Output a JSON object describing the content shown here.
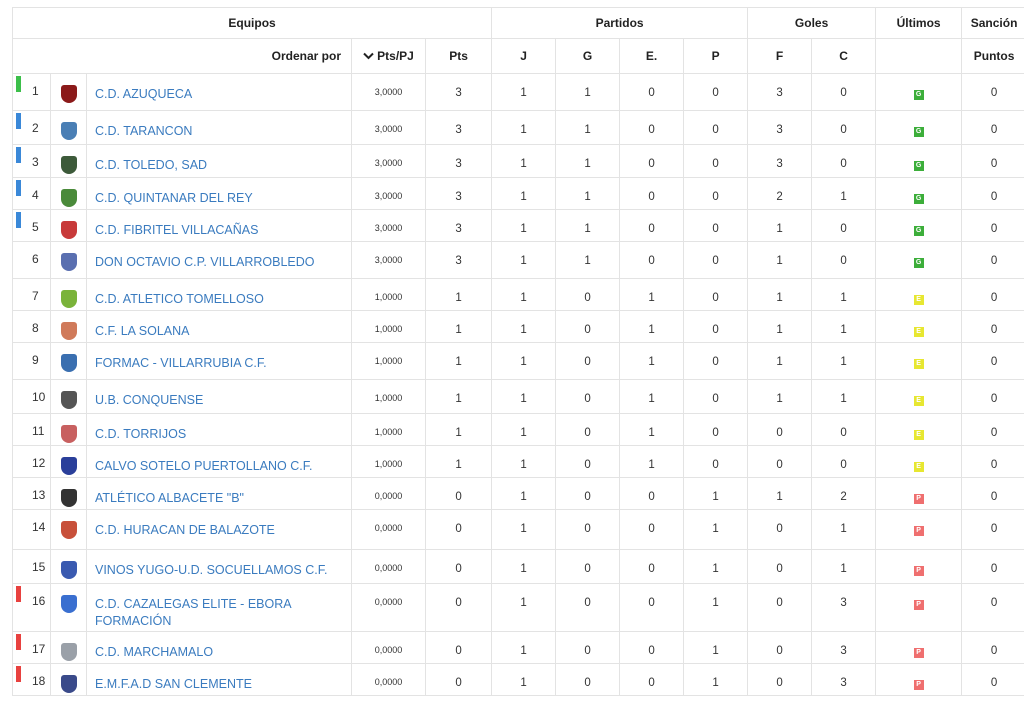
{
  "header": {
    "equipos": "Equipos",
    "partidos": "Partidos",
    "goles": "Goles",
    "ultimos": "Últimos",
    "sancion": "Sanción",
    "ordenar_por": "Ordenar por",
    "sort_icon": "chevron-down-icon",
    "pts_pj": "Pts/PJ",
    "pts": "Pts",
    "j": "J",
    "g": "G",
    "e": "E.",
    "p": "P",
    "f": "F",
    "c": "C",
    "puntos": "Puntos"
  },
  "colors": {
    "promo_green": "#3cbf4a",
    "playoff_blue": "#3a88d8",
    "relegation_red": "#e8413f",
    "win_tag": "#3cae3a",
    "draw_tag": "#e7e731",
    "loss_tag": "#ef6f6f",
    "link": "#3a7bbf"
  },
  "rows": [
    {
      "pos": "1",
      "name": "C.D. AZUQUECA",
      "ptspj": "3,0000",
      "pts": "3",
      "j": "1",
      "g": "1",
      "e": "0",
      "p": "0",
      "f": "3",
      "c": "0",
      "ult": "G",
      "sancion": "0",
      "bar": "green",
      "shield": "#8b1a1a"
    },
    {
      "pos": "2",
      "name": "C.D. TARANCON",
      "ptspj": "3,0000",
      "pts": "3",
      "j": "1",
      "g": "1",
      "e": "0",
      "p": "0",
      "f": "3",
      "c": "0",
      "ult": "G",
      "sancion": "0",
      "bar": "blue",
      "shield": "#4a7fb5"
    },
    {
      "pos": "3",
      "name": "C.D. TOLEDO, SAD",
      "ptspj": "3,0000",
      "pts": "3",
      "j": "1",
      "g": "1",
      "e": "0",
      "p": "0",
      "f": "3",
      "c": "0",
      "ult": "G",
      "sancion": "0",
      "bar": "blue",
      "shield": "#3d5a3a"
    },
    {
      "pos": "4",
      "name": "C.D. QUINTANAR DEL REY",
      "ptspj": "3,0000",
      "pts": "3",
      "j": "1",
      "g": "1",
      "e": "0",
      "p": "0",
      "f": "2",
      "c": "1",
      "ult": "G",
      "sancion": "0",
      "bar": "blue",
      "shield": "#4a8a3a"
    },
    {
      "pos": "5",
      "name": "C.D. FIBRITEL VILLACAÑAS",
      "ptspj": "3,0000",
      "pts": "3",
      "j": "1",
      "g": "1",
      "e": "0",
      "p": "0",
      "f": "1",
      "c": "0",
      "ult": "G",
      "sancion": "0",
      "bar": "blue",
      "shield": "#c83a3a"
    },
    {
      "pos": "6",
      "name": "DON OCTAVIO C.P. VILLARROBLEDO",
      "ptspj": "3,0000",
      "pts": "3",
      "j": "1",
      "g": "1",
      "e": "0",
      "p": "0",
      "f": "1",
      "c": "0",
      "ult": "G",
      "sancion": "0",
      "bar": "",
      "shield": "#5a6fb0"
    },
    {
      "pos": "7",
      "name": "C.D. ATLETICO TOMELLOSO",
      "ptspj": "1,0000",
      "pts": "1",
      "j": "1",
      "g": "0",
      "e": "1",
      "p": "0",
      "f": "1",
      "c": "1",
      "ult": "E",
      "sancion": "0",
      "bar": "",
      "shield": "#7ab33a"
    },
    {
      "pos": "8",
      "name": "C.F. LA SOLANA",
      "ptspj": "1,0000",
      "pts": "1",
      "j": "1",
      "g": "0",
      "e": "1",
      "p": "0",
      "f": "1",
      "c": "1",
      "ult": "E",
      "sancion": "0",
      "bar": "",
      "shield": "#d07a5a"
    },
    {
      "pos": "9",
      "name": "FORMAC - VILLARRUBIA C.F.",
      "ptspj": "1,0000",
      "pts": "1",
      "j": "1",
      "g": "0",
      "e": "1",
      "p": "0",
      "f": "1",
      "c": "1",
      "ult": "E",
      "sancion": "0",
      "bar": "",
      "shield": "#3a6fb0"
    },
    {
      "pos": "10",
      "name": "U.B. CONQUENSE",
      "ptspj": "1,0000",
      "pts": "1",
      "j": "1",
      "g": "0",
      "e": "1",
      "p": "0",
      "f": "1",
      "c": "1",
      "ult": "E",
      "sancion": "0",
      "bar": "",
      "shield": "#555555"
    },
    {
      "pos": "11",
      "name": "C.D. TORRIJOS",
      "ptspj": "1,0000",
      "pts": "1",
      "j": "1",
      "g": "0",
      "e": "1",
      "p": "0",
      "f": "0",
      "c": "0",
      "ult": "E",
      "sancion": "0",
      "bar": "",
      "shield": "#c86060"
    },
    {
      "pos": "12",
      "name": "CALVO SOTELO PUERTOLLANO C.F.",
      "ptspj": "1,0000",
      "pts": "1",
      "j": "1",
      "g": "0",
      "e": "1",
      "p": "0",
      "f": "0",
      "c": "0",
      "ult": "E",
      "sancion": "0",
      "bar": "",
      "shield": "#2a3f9a"
    },
    {
      "pos": "13",
      "name": "ATLÉTICO ALBACETE \"B\"",
      "ptspj": "0,0000",
      "pts": "0",
      "j": "1",
      "g": "0",
      "e": "0",
      "p": "1",
      "f": "1",
      "c": "2",
      "ult": "P",
      "sancion": "0",
      "bar": "",
      "shield": "#333333"
    },
    {
      "pos": "14",
      "name": "C.D. HURACAN DE BALAZOTE",
      "ptspj": "0,0000",
      "pts": "0",
      "j": "1",
      "g": "0",
      "e": "0",
      "p": "1",
      "f": "0",
      "c": "1",
      "ult": "P",
      "sancion": "0",
      "bar": "",
      "shield": "#c8503a"
    },
    {
      "pos": "15",
      "name": "VINOS YUGO-U.D. SOCUELLAMOS C.F.",
      "ptspj": "0,0000",
      "pts": "0",
      "j": "1",
      "g": "0",
      "e": "0",
      "p": "1",
      "f": "0",
      "c": "1",
      "ult": "P",
      "sancion": "0",
      "bar": "",
      "shield": "#3a5ab0"
    },
    {
      "pos": "16",
      "name": "C.D. CAZALEGAS ELITE - EBORA FORMACIÓN",
      "ptspj": "0,0000",
      "pts": "0",
      "j": "1",
      "g": "0",
      "e": "0",
      "p": "1",
      "f": "0",
      "c": "3",
      "ult": "P",
      "sancion": "0",
      "bar": "red",
      "shield": "#3a6fd0"
    },
    {
      "pos": "17",
      "name": "C.D. MARCHAMALO",
      "ptspj": "0,0000",
      "pts": "0",
      "j": "1",
      "g": "0",
      "e": "0",
      "p": "1",
      "f": "0",
      "c": "3",
      "ult": "P",
      "sancion": "0",
      "bar": "red",
      "shield": "#9aa0a8"
    },
    {
      "pos": "18",
      "name": "E.M.F.A.D SAN CLEMENTE",
      "ptspj": "0,0000",
      "pts": "0",
      "j": "1",
      "g": "0",
      "e": "0",
      "p": "1",
      "f": "0",
      "c": "3",
      "ult": "P",
      "sancion": "0",
      "bar": "red",
      "shield": "#3a4a8a"
    }
  ]
}
